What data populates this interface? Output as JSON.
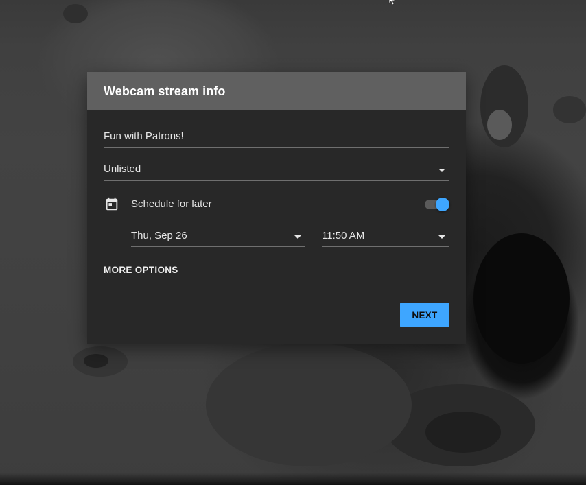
{
  "dialog": {
    "title": "Webcam stream info",
    "stream_title": {
      "value": "Fun with Patrons!"
    },
    "privacy": {
      "selected": "Unlisted"
    },
    "schedule": {
      "icon": "calendar-icon",
      "label": "Schedule for later",
      "enabled": true,
      "date": "Thu, Sep 26",
      "time": "11:50 AM"
    },
    "more_options_label": "MORE OPTIONS",
    "next_label": "NEXT"
  },
  "colors": {
    "accent": "#3ea6ff",
    "dialog_bg": "#282828",
    "header_bg": "#606060"
  }
}
